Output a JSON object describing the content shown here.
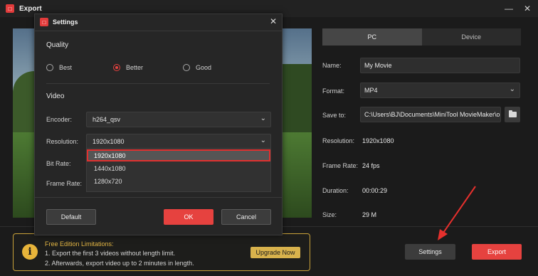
{
  "window": {
    "title": "Export"
  },
  "tabs": [
    {
      "label": "PC"
    },
    {
      "label": "Device"
    }
  ],
  "fields": {
    "name_label": "Name:",
    "name_value": "My Movie",
    "format_label": "Format:",
    "format_value": "MP4",
    "save_label": "Save to:",
    "save_value": "C:\\Users\\BJ\\Documents\\MiniTool MovieMaker\\outp",
    "resolution_label": "Resolution:",
    "resolution_value": "1920x1080",
    "framerate_label": "Frame Rate:",
    "framerate_value": "24 fps",
    "duration_label": "Duration:",
    "duration_value": "00:00:29",
    "size_label": "Size:",
    "size_value": "29 M"
  },
  "limits": {
    "title": "Free Edition Limitations:",
    "line1": "1. Export the first 3 videos without length limit.",
    "line2": "2. Afterwards, export video up to 2 minutes in length.",
    "upgrade_label": "Upgrade Now"
  },
  "buttons": {
    "settings": "Settings",
    "export": "Export"
  },
  "dialog": {
    "title": "Settings",
    "quality_title": "Quality",
    "quality_options": [
      {
        "label": "Best",
        "checked": false
      },
      {
        "label": "Better",
        "checked": true
      },
      {
        "label": "Good",
        "checked": false
      }
    ],
    "video_title": "Video",
    "encoder_label": "Encoder:",
    "encoder_value": "h264_qsv",
    "resolution_label": "Resolution:",
    "resolution_value": "1920x1080",
    "bitrate_label": "Bit Rate:",
    "framerate_label": "Frame Rate:",
    "resolution_options": [
      "1920x1080",
      "1440x1080",
      "1280x720"
    ],
    "default_label": "Default",
    "ok_label": "OK",
    "cancel_label": "Cancel"
  },
  "colors": {
    "accent": "#e6423f",
    "warning": "#e7b43a",
    "highlight": "#e0302f"
  },
  "icons": [
    "app-logo-icon",
    "minimize-icon",
    "close-icon",
    "chevron-down-icon",
    "folder-icon",
    "info-icon"
  ]
}
